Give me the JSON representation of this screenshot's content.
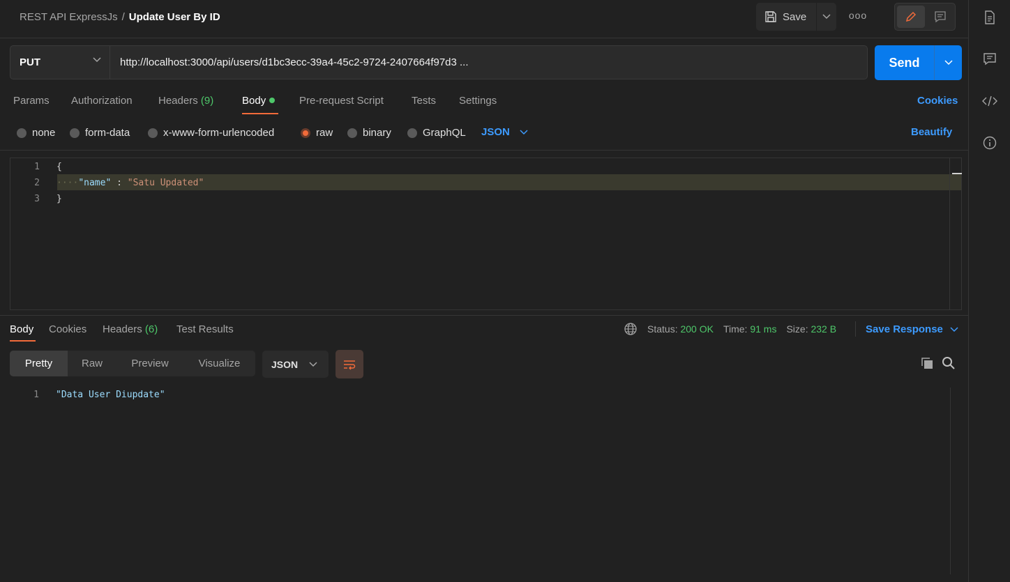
{
  "header": {
    "collection": "REST API ExpressJs",
    "separator": "/",
    "request_name": "Update User By ID",
    "save_label": "Save",
    "more_label": "ooo"
  },
  "request": {
    "method": "PUT",
    "url": "http://localhost:3000/api/users/d1bc3ecc-39a4-45c2-9724-2407664f97d3 ...",
    "send_label": "Send"
  },
  "request_tabs": {
    "params": "Params",
    "authorization": "Authorization",
    "headers": "Headers",
    "headers_count": "(9)",
    "body": "Body",
    "pre_request": "Pre-request Script",
    "tests": "Tests",
    "settings": "Settings",
    "cookies": "Cookies"
  },
  "body_types": {
    "none": "none",
    "form_data": "form-data",
    "urlencoded": "x-www-form-urlencoded",
    "raw": "raw",
    "binary": "binary",
    "graphql": "GraphQL",
    "selected": "raw",
    "language": "JSON",
    "beautify": "Beautify"
  },
  "editor": {
    "lines": [
      {
        "n": "1",
        "open": "{"
      },
      {
        "n": "2",
        "key": "\"name\"",
        "colon": " : ",
        "value": "\"Satu Updated\""
      },
      {
        "n": "3",
        "close": "}"
      }
    ]
  },
  "response": {
    "tabs": {
      "body": "Body",
      "cookies": "Cookies",
      "headers": "Headers",
      "headers_count": "(6)",
      "test_results": "Test Results"
    },
    "status_label": "Status:",
    "status_value": "200 OK",
    "time_label": "Time:",
    "time_value": "91 ms",
    "size_label": "Size:",
    "size_value": "232 B",
    "save_response": "Save Response",
    "views": {
      "pretty": "Pretty",
      "raw": "Raw",
      "preview": "Preview",
      "visualize": "Visualize"
    },
    "format": "JSON",
    "lines": [
      {
        "n": "1",
        "text": "\"Data User Diupdate\""
      }
    ]
  },
  "colors": {
    "accent_orange": "#f26b3a",
    "send_blue": "#097bed",
    "link_blue": "#3d9bff",
    "success_green": "#4ec76a"
  }
}
